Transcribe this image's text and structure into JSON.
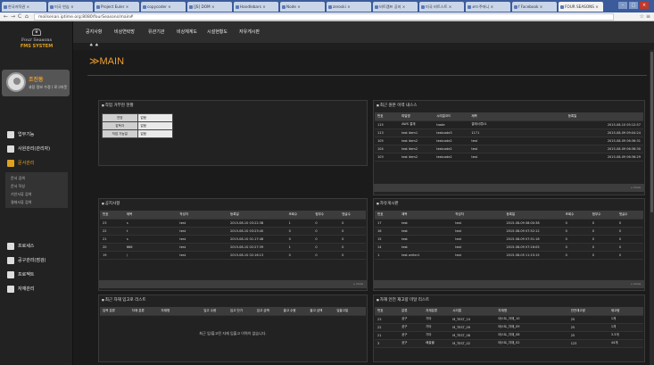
{
  "browser": {
    "tabs": [
      "한국저작권 ×",
      "미국 연습 ×",
      "Project Euler ×",
      "copycoder ×",
      "[JS] DOM ×",
      "Handlebars ×",
      "Node ×",
      "zeroski ×",
      "비트캠프 공지 ×",
      "미국 비트스트 ×",
      "코드주머니 ×",
      "f Facebook ×",
      "FOUR SEASONS ×"
    ],
    "url": "moilsenan.iptime.org:8080/fourSeasons/main#",
    "window_buttons": [
      "–",
      "□",
      "×"
    ]
  },
  "sidebar": {
    "logo_line1": "Four Seasons",
    "logo_line2": "FMS SYSTEM",
    "profile_name": "조진동",
    "profile_desc": "과장 정보 수정 / 로그아웃",
    "menu": [
      {
        "label": "업무기능",
        "hot": false
      },
      {
        "label": "사원관리(관리자)",
        "hot": false
      },
      {
        "label": "문서관리",
        "hot": true
      },
      {
        "label": "프로세스",
        "hot": false
      },
      {
        "label": "공구관리(점검)",
        "hot": false
      },
      {
        "label": "프로젝트",
        "hot": false
      },
      {
        "label": "자재관리",
        "hot": false
      }
    ],
    "submenu": [
      "문서 검색",
      "문서 작성",
      "기안서류 검색",
      "결재서류 검색"
    ]
  },
  "topnav": {
    "items": [
      "공지사항",
      "비상연락망",
      "유관기관",
      "비상체계도",
      "시설현황도",
      "자유게시판"
    ]
  },
  "breadcrumb": "♠ ♠",
  "main_title": "≫MAIN",
  "status_panel": {
    "title": "작업 거부현 현황",
    "rows": [
      {
        "k": "연장",
        "v": "없음"
      },
      {
        "k": "감독자",
        "v": "없음"
      },
      {
        "k": "작업 가능일",
        "v": "없음"
      }
    ]
  },
  "recent_panel": {
    "title": "최근 원본 이력 내스스",
    "headers": [
      "번호",
      "파일명",
      "시리얼코드",
      "제목",
      "",
      "",
      "",
      "",
      "등록일"
    ],
    "rows": [
      [
        "115",
        "AWS 결재",
        "trade",
        "결재서류01",
        "2015-08-10 05:12:57"
      ],
      [
        "113",
        "test item1",
        "testcode3",
        "1171",
        "2015-08-09 09:04:24"
      ],
      [
        "105",
        "test item2",
        "testcode2",
        "test",
        "2015-08-09 06:36:31"
      ],
      [
        "104",
        "test item2",
        "testcode2",
        "test",
        "2015-08-09 06:36:30"
      ],
      [
        "103",
        "test item2",
        "testcode2",
        "test",
        "2015-08-09 06:36:29"
      ]
    ],
    "more": "+ more"
  },
  "notice_panel": {
    "title": "공지사항",
    "headers": [
      "번호",
      "제목",
      "작성자",
      "등록일",
      "조회수",
      "첨부수",
      "댓글수"
    ],
    "rows": [
      [
        "23",
        "s",
        "test",
        "2015-08-10 03:22:38",
        "1",
        "0",
        "0"
      ],
      [
        "22",
        "t",
        "test",
        "2015-08-10 03:23:40",
        "0",
        "0",
        "0"
      ],
      [
        "21",
        "s",
        "test",
        "2015-08-10 01:17:48",
        "0",
        "0",
        "0"
      ],
      [
        "20",
        "666",
        "test",
        "2015-08-10 02:27:39",
        "1",
        "0",
        "0"
      ],
      [
        "19",
        "/",
        "test",
        "2015-08-10 02:16:13",
        "0",
        "0",
        "0"
      ]
    ],
    "more": "+ more"
  },
  "free_panel": {
    "title": "자유게시판",
    "headers": [
      "번호",
      "제목",
      "작성자",
      "등록일",
      "조회수",
      "첨부수",
      "댓글수"
    ],
    "rows": [
      [
        "17",
        "test",
        "test",
        "2015-08-09 08:00:38",
        "0",
        "0",
        "0"
      ],
      [
        "16",
        "test",
        "test",
        "2015-08-09 07:52:12",
        "0",
        "0",
        "0"
      ],
      [
        "15",
        "test",
        "test",
        "2015-08-09 07:51:18",
        "0",
        "0",
        "0"
      ],
      [
        "14",
        "test",
        "test",
        "2015-08-09 07:16:05",
        "0",
        "0",
        "0"
      ],
      [
        "1",
        "test writer1",
        "test",
        "2015-08-05 11:15:15",
        "0",
        "0",
        "0"
      ]
    ],
    "more": "+ more"
  },
  "upload_panel": {
    "title": "최근 자재 입고로 리스트",
    "headers": [
      "입력 분류",
      "자재 분류",
      "자재명",
      "입고 수량",
      "입고 단가",
      "입고 금액",
      "출고 수량",
      "출고 금액",
      "입출고일"
    ],
    "empty": "최근 입/출고된 자재 입출고 이력이 없습니다."
  },
  "hazard_panel": {
    "title": "자재 안전 재고량 미달 리스트",
    "headers": [
      "번호",
      "분류",
      "자재분류",
      "시리얼",
      "자재명",
      "안전재고량",
      "재고량"
    ],
    "rows": [
      [
        "23",
        "공구",
        "기타",
        "M_TEST_10",
        "테스트_자재_10",
        "25",
        "1개"
      ],
      [
        "22",
        "공구",
        "기타",
        "M_TEST_09",
        "테스트_자재_09",
        "25",
        "1개"
      ],
      [
        "21",
        "공구",
        "기타",
        "M_TEST_08",
        "테스트_자재_08",
        "25",
        "3.3개"
      ],
      [
        "3",
        "공구",
        "배출물",
        "M_TEST_02",
        "테스트_자재_02",
        "123",
        "44개"
      ]
    ]
  }
}
